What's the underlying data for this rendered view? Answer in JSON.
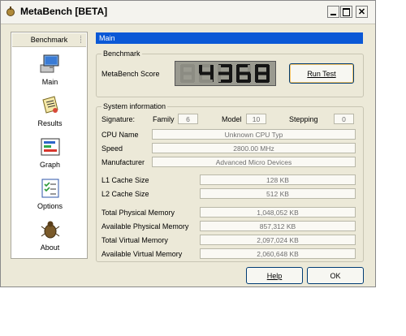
{
  "window": {
    "title": "MetaBench [BETA]"
  },
  "sidebar": {
    "header": "Benchmark",
    "items": [
      {
        "label": "Main",
        "icon": "computer-icon"
      },
      {
        "label": "Results",
        "icon": "results-scroll-icon"
      },
      {
        "label": "Graph",
        "icon": "graph-icon"
      },
      {
        "label": "Options",
        "icon": "options-checklist-icon"
      },
      {
        "label": "About",
        "icon": "about-bug-icon"
      }
    ]
  },
  "main": {
    "header": "Main",
    "benchmark": {
      "title": "Benchmark",
      "score_label": "MetaBench Score",
      "score_digits": [
        "",
        "4",
        "3",
        "6",
        "8"
      ],
      "run_button": "Run Test"
    },
    "sysinfo": {
      "title": "System information",
      "signature_label": "Signature:",
      "family_label": "Family",
      "family_value": "6",
      "model_label": "Model",
      "model_value": "10",
      "stepping_label": "Stepping",
      "stepping_value": "0",
      "cpu_name_label": "CPU Name",
      "cpu_name_value": "Unknown CPU Typ",
      "speed_label": "Speed",
      "speed_value": "2800.00 MHz",
      "manufacturer_label": "Manufacturer",
      "manufacturer_value": "Advanced Micro Devices",
      "l1_label": "L1 Cache Size",
      "l1_value": "128 KB",
      "l2_label": "L2 Cache Size",
      "l2_value": "512 KB",
      "tpm_label": "Total Physical Memory",
      "tpm_value": "1,048,052 KB",
      "apm_label": "Available Physical Memory",
      "apm_value": "857,312 KB",
      "tvm_label": "Total Virtual Memory",
      "tvm_value": "2,097,024 KB",
      "avm_label": "Available Virtual Memory",
      "avm_value": "2,060,648 KB"
    },
    "help_button": "Help",
    "ok_button": "OK"
  },
  "colors": {
    "header_blue": "#0a58d6",
    "lcd_bg": "#9a9a90",
    "lcd_digit": "#141414"
  }
}
